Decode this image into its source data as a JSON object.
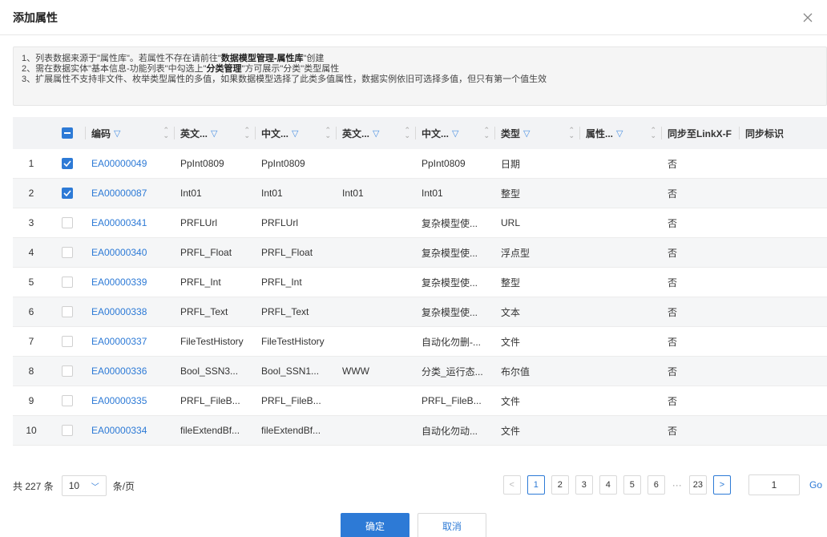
{
  "dialog": {
    "title": "添加属性",
    "close_icon": "close-icon"
  },
  "notice": {
    "line1_prefix": "1、列表数据来源于\"属性库\"。若属性不存在请前往\"",
    "line1_bold": "数据模型管理-属性库",
    "line1_suffix": "\"创建",
    "line2_prefix": "2、需在数据实体\"基本信息-功能列表\"中勾选上\"",
    "line2_bold": "分类管理",
    "line2_suffix": "\"方可展示\"分类\"类型属性",
    "line3": "3、扩展属性不支持非文件、枚举类型属性的多值，如果数据模型选择了此类多值属性，数据实例依旧可选择多值，但只有第一个值生效"
  },
  "table": {
    "columns": {
      "code": "编码",
      "en_name": "英文...",
      "cn_name": "中文...",
      "en_desc": "英文...",
      "cn_desc": "中文...",
      "type": "类型",
      "attr": "属性...",
      "sync": "同步至LinkX-F",
      "flag": "同步标识"
    },
    "rows": [
      {
        "idx": "1",
        "checked": true,
        "code": "EA00000049",
        "en_name": "PpInt0809",
        "cn_name": "PpInt0809",
        "en_desc": "",
        "cn_desc": "PpInt0809",
        "type": "日期",
        "attr": "",
        "sync": "否",
        "flag": ""
      },
      {
        "idx": "2",
        "checked": true,
        "code": "EA00000087",
        "en_name": "Int01",
        "cn_name": "Int01",
        "en_desc": "Int01",
        "cn_desc": "Int01",
        "type": "整型",
        "attr": "",
        "sync": "否",
        "flag": ""
      },
      {
        "idx": "3",
        "checked": false,
        "code": "EA00000341",
        "en_name": "PRFLUrl",
        "cn_name": "PRFLUrl",
        "en_desc": "",
        "cn_desc": "复杂模型使...",
        "type": "URL",
        "attr": "",
        "sync": "否",
        "flag": ""
      },
      {
        "idx": "4",
        "checked": false,
        "code": "EA00000340",
        "en_name": "PRFL_Float",
        "cn_name": "PRFL_Float",
        "en_desc": "",
        "cn_desc": "复杂模型使...",
        "type": "浮点型",
        "attr": "",
        "sync": "否",
        "flag": ""
      },
      {
        "idx": "5",
        "checked": false,
        "code": "EA00000339",
        "en_name": "PRFL_Int",
        "cn_name": "PRFL_Int",
        "en_desc": "",
        "cn_desc": "复杂模型使...",
        "type": "整型",
        "attr": "",
        "sync": "否",
        "flag": ""
      },
      {
        "idx": "6",
        "checked": false,
        "code": "EA00000338",
        "en_name": "PRFL_Text",
        "cn_name": "PRFL_Text",
        "en_desc": "",
        "cn_desc": "复杂模型使...",
        "type": "文本",
        "attr": "",
        "sync": "否",
        "flag": ""
      },
      {
        "idx": "7",
        "checked": false,
        "code": "EA00000337",
        "en_name": "FileTestHistory",
        "cn_name": "FileTestHistory",
        "en_desc": "",
        "cn_desc": "自动化勿删-...",
        "type": "文件",
        "attr": "",
        "sync": "否",
        "flag": ""
      },
      {
        "idx": "8",
        "checked": false,
        "code": "EA00000336",
        "en_name": "Bool_SSN3...",
        "cn_name": "Bool_SSN1...",
        "en_desc": "WWW",
        "cn_desc": "分类_运行态...",
        "type": "布尔值",
        "attr": "",
        "sync": "否",
        "flag": ""
      },
      {
        "idx": "9",
        "checked": false,
        "code": "EA00000335",
        "en_name": "PRFL_FileB...",
        "cn_name": "PRFL_FileB...",
        "en_desc": "",
        "cn_desc": "PRFL_FileB...",
        "type": "文件",
        "attr": "",
        "sync": "否",
        "flag": ""
      },
      {
        "idx": "10",
        "checked": false,
        "code": "EA00000334",
        "en_name": "fileExtendBf...",
        "cn_name": "fileExtendBf...",
        "en_desc": "",
        "cn_desc": "自动化勿动...",
        "type": "文件",
        "attr": "",
        "sync": "否",
        "flag": ""
      }
    ]
  },
  "pagination": {
    "total": "共 227 条",
    "page_size": "10",
    "per_page": "条/页",
    "pages": [
      "1",
      "2",
      "3",
      "4",
      "5",
      "6"
    ],
    "ellipsis": "···",
    "last_page": "23",
    "current": "1",
    "jump_value": "1",
    "go_label": "Go"
  },
  "actions": {
    "confirm": "确定",
    "cancel": "取消"
  },
  "colors": {
    "accent": "#2d7ad6",
    "header_bg": "#f2f3f5",
    "alt_row_bg": "#f5f6f7"
  }
}
